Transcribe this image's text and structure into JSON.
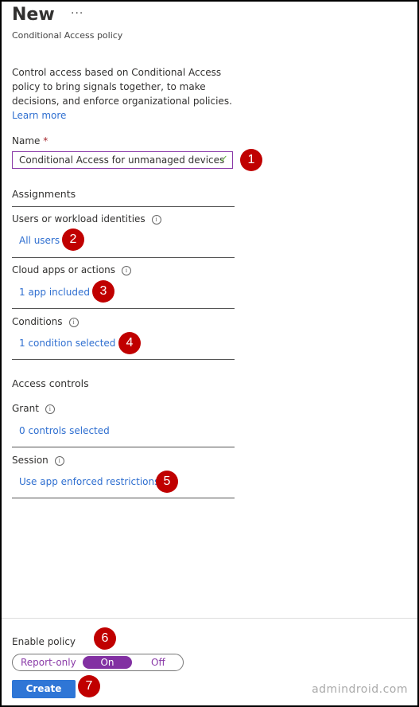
{
  "header": {
    "title": "New",
    "more": "···",
    "subtitle": "Conditional Access policy"
  },
  "intro": {
    "description": "Control access based on Conditional Access policy to bring signals together, to make decisions, and enforce organizational policies.",
    "learn_more": "Learn more"
  },
  "name_field": {
    "label": "Name",
    "required": "*",
    "value": "Conditional Access for unmanaged devices",
    "valid_icon": "check-icon"
  },
  "assignments": {
    "heading": "Assignments",
    "users": {
      "label": "Users or workload identities",
      "value": "All users"
    },
    "cloud_apps": {
      "label": "Cloud apps or actions",
      "value": "1 app included"
    },
    "conditions": {
      "label": "Conditions",
      "value": "1 condition selected"
    }
  },
  "access_controls": {
    "heading": "Access controls",
    "grant": {
      "label": "Grant",
      "value": "0 controls selected"
    },
    "session": {
      "label": "Session",
      "value": "Use app enforced restrictions"
    }
  },
  "info_glyph": "i",
  "enable_policy": {
    "label": "Enable policy",
    "options": [
      "Report-only",
      "On",
      "Off"
    ],
    "selected": "On"
  },
  "create_label": "Create",
  "badges": [
    "1",
    "2",
    "3",
    "4",
    "5",
    "6",
    "7"
  ],
  "watermark": "admindroid.com",
  "colors": {
    "accent": "#8230a2",
    "link": "#2f6fd0",
    "primary_button": "#2f76d6",
    "badge": "#c00000"
  }
}
